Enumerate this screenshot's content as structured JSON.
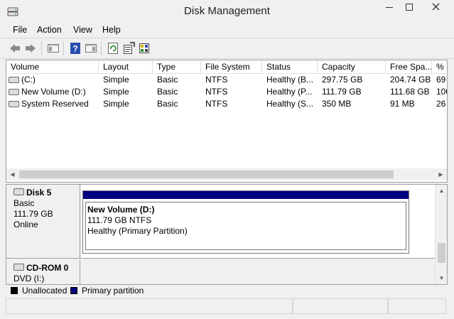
{
  "window": {
    "title": "Disk Management"
  },
  "menu": [
    "File",
    "Action",
    "View",
    "Help"
  ],
  "toolbar": [
    "back-icon",
    "forward-icon",
    "console-tree-icon",
    "help-icon",
    "properties-view-icon",
    "refresh-icon",
    "properties-icon",
    "settings-icon"
  ],
  "volume_list": {
    "columns": [
      "Volume",
      "Layout",
      "Type",
      "File System",
      "Status",
      "Capacity",
      "Free Spa...",
      "% F"
    ],
    "rows": [
      [
        "(C:)",
        "Simple",
        "Basic",
        "NTFS",
        "Healthy (B...",
        "297.75 GB",
        "204.74 GB",
        "69"
      ],
      [
        "New Volume (D:)",
        "Simple",
        "Basic",
        "NTFS",
        "Healthy (P...",
        "111.79 GB",
        "111.68 GB",
        "100"
      ],
      [
        "System Reserved",
        "Simple",
        "Basic",
        "NTFS",
        "Healthy (S...",
        "350 MB",
        "91 MB",
        "26"
      ]
    ]
  },
  "disks": [
    {
      "name": "Disk 5",
      "type": "Basic",
      "size": "111.79 GB",
      "state": "Online",
      "partition": {
        "name": "New Volume  (D:)",
        "size_fs": "111.79 GB NTFS",
        "status": "Healthy (Primary Partition)"
      }
    },
    {
      "name": "CD-ROM 0",
      "type": "DVD (I:)"
    }
  ],
  "legend": [
    {
      "label": "Unallocated",
      "color": "#000000"
    },
    {
      "label": "Primary partition",
      "color": "#00007d"
    }
  ]
}
